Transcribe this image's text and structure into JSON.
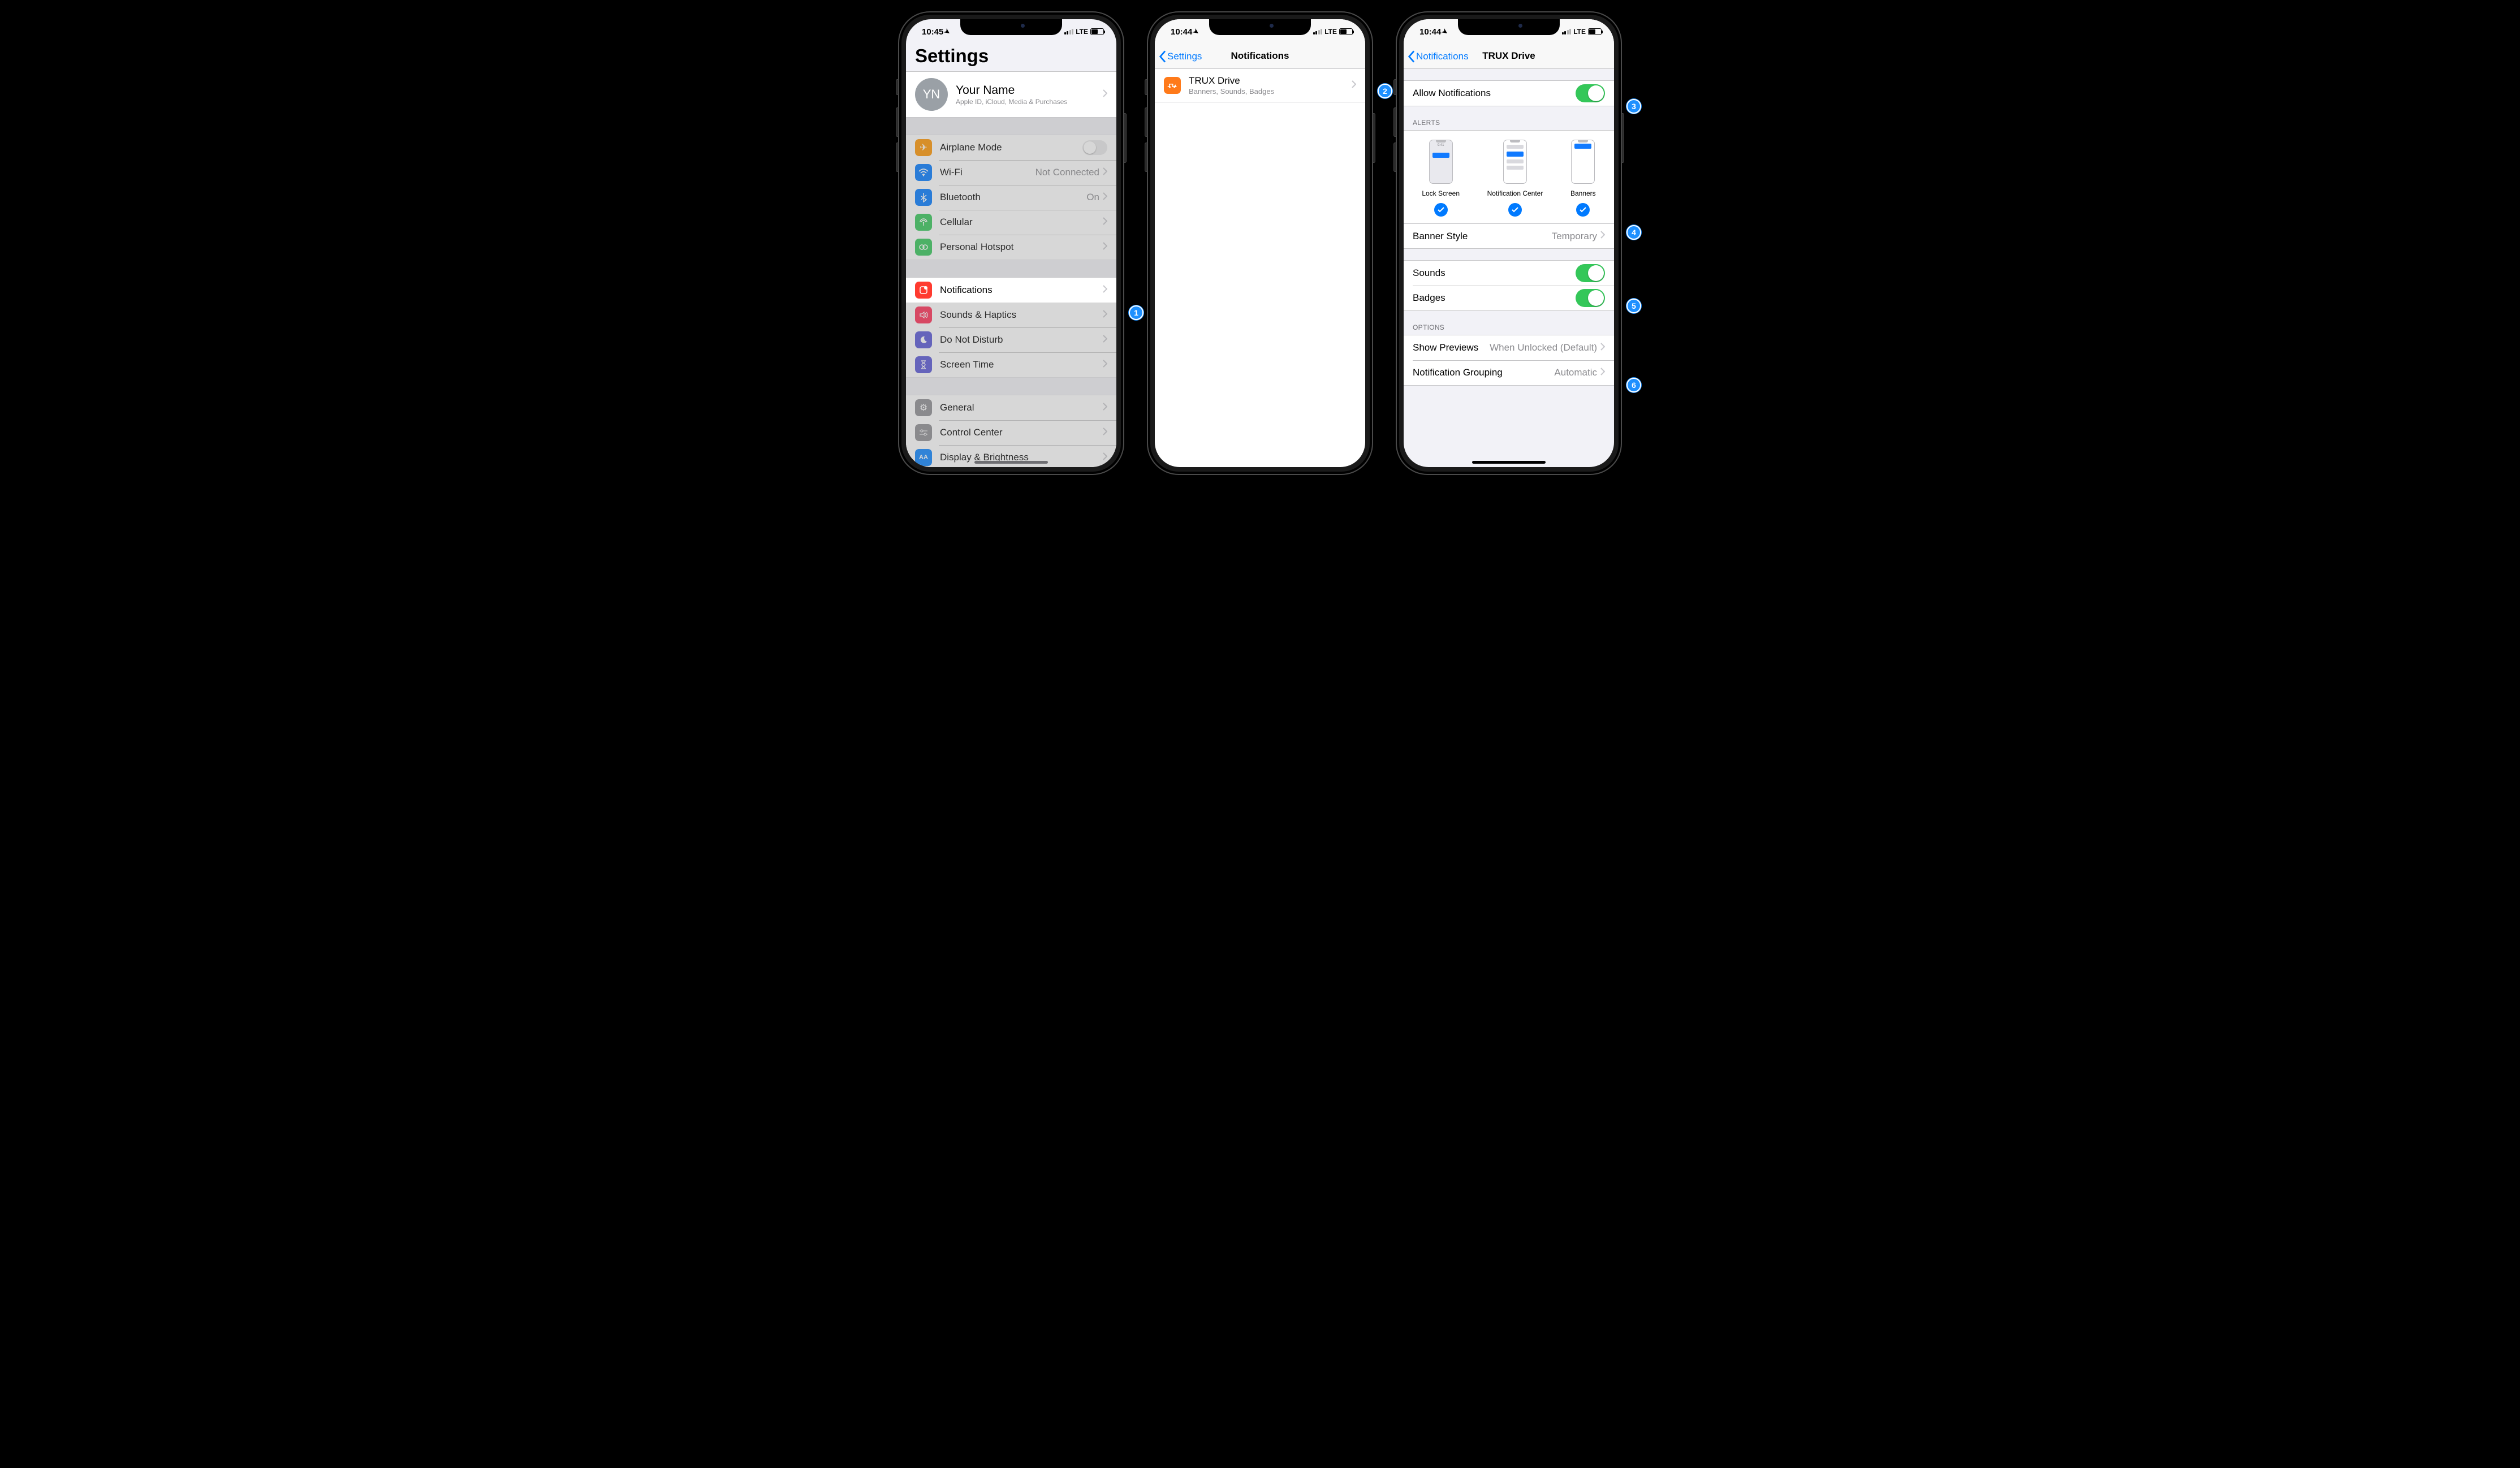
{
  "colors": {
    "ios_blue": "#007aff",
    "ios_green": "#34c759"
  },
  "phone1": {
    "status_time": "10:45",
    "status_net": "LTE",
    "large_title": "Settings",
    "profile": {
      "initials": "YN",
      "name": "Your Name",
      "subtitle": "Apple ID, iCloud, Media & Purchases"
    },
    "group1": [
      {
        "id": "airplane",
        "label": "Airplane Mode",
        "icon_bg": "#ff9500",
        "value": "",
        "toggle": true,
        "toggle_on": false
      },
      {
        "id": "wifi",
        "label": "Wi-Fi",
        "icon_bg": "#007aff",
        "value": "Not Connected"
      },
      {
        "id": "bluetooth",
        "label": "Bluetooth",
        "icon_bg": "#007aff",
        "value": "On"
      },
      {
        "id": "cellular",
        "label": "Cellular",
        "icon_bg": "#34c759",
        "value": ""
      },
      {
        "id": "hotspot",
        "label": "Personal Hotspot",
        "icon_bg": "#34c759",
        "value": ""
      }
    ],
    "group2_highlight": {
      "id": "notifications",
      "label": "Notifications",
      "icon_bg": "#ff3b30"
    },
    "group2_rest": [
      {
        "id": "sounds",
        "label": "Sounds & Haptics",
        "icon_bg": "#ff2d55"
      },
      {
        "id": "dnd",
        "label": "Do Not Disturb",
        "icon_bg": "#5856d6"
      },
      {
        "id": "screentime",
        "label": "Screen Time",
        "icon_bg": "#5856d6"
      }
    ],
    "group3": [
      {
        "id": "general",
        "label": "General",
        "icon_bg": "#8e8e93"
      },
      {
        "id": "controlcenter",
        "label": "Control Center",
        "icon_bg": "#8e8e93"
      },
      {
        "id": "display",
        "label": "Display & Brightness",
        "icon_bg": "#0a84ff"
      }
    ]
  },
  "phone2": {
    "status_time": "10:44",
    "status_net": "LTE",
    "nav_back": "Settings",
    "nav_title": "Notifications",
    "app": {
      "name": "TRUX Drive",
      "subtitle": "Banners, Sounds, Badges"
    }
  },
  "phone3": {
    "status_time": "10:44",
    "status_net": "LTE",
    "nav_back": "Notifications",
    "nav_title": "TRUX Drive",
    "allow_label": "Allow Notifications",
    "allow_on": true,
    "alerts_header": "ALERTS",
    "alert_options": [
      {
        "id": "lock",
        "label": "Lock Screen",
        "checked": true
      },
      {
        "id": "center",
        "label": "Notification Center",
        "checked": true
      },
      {
        "id": "banners",
        "label": "Banners",
        "checked": true
      }
    ],
    "mini_clock": "9:41",
    "banner_style_label": "Banner Style",
    "banner_style_value": "Temporary",
    "sounds_label": "Sounds",
    "sounds_on": true,
    "badges_label": "Badges",
    "badges_on": true,
    "options_header": "OPTIONS",
    "previews_label": "Show Previews",
    "previews_value": "When Unlocked (Default)",
    "grouping_label": "Notification Grouping",
    "grouping_value": "Automatic"
  },
  "callouts": [
    "1",
    "2",
    "3",
    "4",
    "5",
    "6"
  ]
}
